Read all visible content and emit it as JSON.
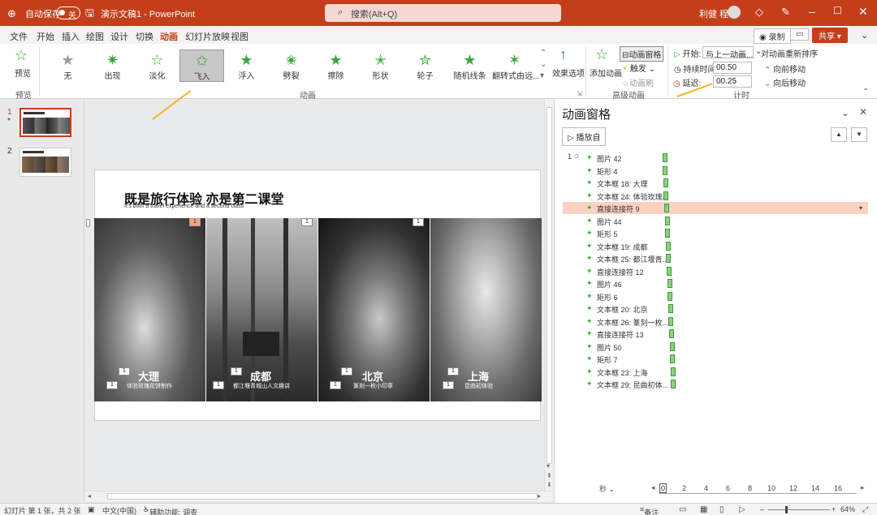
{
  "titlebar": {
    "autosave_label": "自动保存",
    "autosave_state": "关",
    "doc_title": "演示文稿1 - PowerPoint",
    "search_placeholder": "搜索(Alt+Q)",
    "user_name": "利健 程"
  },
  "menu": {
    "tabs": [
      "文件",
      "开始",
      "插入",
      "绘图",
      "设计",
      "切换",
      "动画",
      "幻灯片放映",
      "视图"
    ],
    "active_tab": "动画",
    "record_label": "录制",
    "share_label": "共享"
  },
  "ribbon": {
    "preview_label": "预览",
    "preview_group": "预览",
    "gallery": [
      {
        "label": "无"
      },
      {
        "label": "出现"
      },
      {
        "label": "淡化"
      },
      {
        "label": "飞入"
      },
      {
        "label": "浮入"
      },
      {
        "label": "劈裂"
      },
      {
        "label": "擦除"
      },
      {
        "label": "形状"
      },
      {
        "label": "轮子"
      },
      {
        "label": "随机线条"
      },
      {
        "label": "翻转式由远..."
      }
    ],
    "selected_effect": "飞入",
    "animation_group": "动画",
    "effect_options": "效果选项",
    "add_animation": "添加动画",
    "animation_pane_btn": "动画窗格",
    "trigger": "触发",
    "animation_painter": "动画刷",
    "advanced_group": "高级动画",
    "start_label": "开始:",
    "start_value": "与上一动画...",
    "duration_label": "持续时间:",
    "duration_value": "00.50",
    "delay_label": "延迟:",
    "delay_value": "00.25",
    "reorder_label": "对动画重新排序",
    "move_earlier": "向前移动",
    "move_later": "向后移动",
    "timing_group": "计时"
  },
  "thumbnails": [
    {
      "num": "1",
      "mark": "*"
    },
    {
      "num": "2",
      "mark": ""
    }
  ],
  "slide": {
    "title": "既是旅行体验 亦是第二课堂",
    "subtitle": "It's both a travel experience and a second class",
    "panels": [
      {
        "city": "大理",
        "caption": "体验玫瑰花饼制作",
        "tag": "1",
        "tag_orange": true
      },
      {
        "city": "成都",
        "caption": "都江堰青城山人文趣讲",
        "tag": "1",
        "tag_orange": false
      },
      {
        "city": "北京",
        "caption": "篆刻一枚小印章",
        "tag": "1",
        "tag_orange": false
      },
      {
        "city": "上海",
        "caption": "昆曲初体验",
        "tag": "1",
        "tag_orange": false
      }
    ],
    "order_badge": "1"
  },
  "pane": {
    "title": "动画窗格",
    "play_label": "播放自",
    "seq_num": "1",
    "items": [
      "图片 42",
      "矩形 4",
      "文本框 18: 大理",
      "文本框 24: 体验玫瑰...",
      "直接连接符 9",
      "图片 44",
      "矩形 5",
      "文本框 19: 成都",
      "文本框 25: 都江堰青...",
      "直接连接符 12",
      "图片 46",
      "矩形 6",
      "文本框 20: 北京",
      "文本框 26: 篆刻一枚...",
      "直接连接符 13",
      "图片 50",
      "矩形 7",
      "文本框 23: 上海",
      "文本框 29: 昆曲初体..."
    ],
    "highlighted_index": 4,
    "timeline_unit": "秒",
    "timeline_ticks": [
      "0",
      "2",
      "4",
      "6",
      "8",
      "10",
      "12",
      "14",
      "16"
    ]
  },
  "statusbar": {
    "slide_info": "幻灯片 第 1 张，共 2 张",
    "language": "中文(中国)",
    "accessibility": "辅助功能: 调查",
    "notes": "备注",
    "zoom": "64%"
  }
}
